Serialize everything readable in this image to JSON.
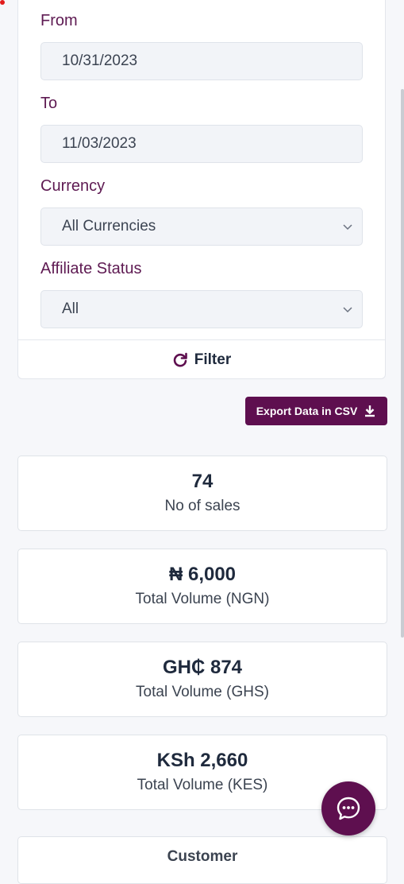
{
  "filters": {
    "from_label": "From",
    "from_value": "10/31/2023",
    "to_label": "To",
    "to_value": "11/03/2023",
    "currency_label": "Currency",
    "currency_value": "All Currencies",
    "affiliate_label": "Affiliate Status",
    "affiliate_value": "All",
    "filter_button": "Filter"
  },
  "export_button": "Export Data in CSV",
  "stats": [
    {
      "value": "74",
      "caption": "No of sales"
    },
    {
      "value": "₦ 6,000",
      "caption": "Total Volume (NGN)"
    },
    {
      "value": "GH₵ 874",
      "caption": "Total Volume (GHS)"
    },
    {
      "value": "KSh 2,660",
      "caption": "Total Volume (KES)"
    }
  ],
  "partial_card_label": "Customer",
  "colors": {
    "brand": "#5e0f4f",
    "label": "#5e1a52"
  }
}
